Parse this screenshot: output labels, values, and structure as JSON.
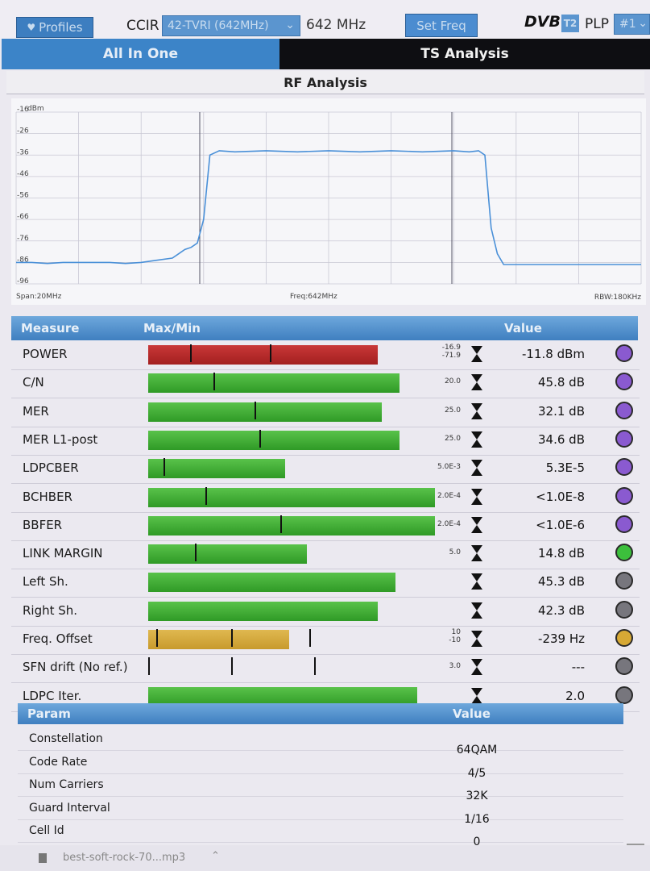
{
  "topbar": {
    "profiles_label": "Profiles",
    "standard": "CCIR",
    "channel": "42-TVRI (642MHz)",
    "frequency": "642 MHz",
    "set_freq_label": "Set Freq",
    "system": "DVB",
    "system_version": "T2",
    "plp_label": "PLP",
    "plp_value": "#1"
  },
  "tabs": [
    {
      "label": "All In One",
      "active": false
    },
    {
      "label": "TS Analysis",
      "active": true
    }
  ],
  "rf": {
    "title": "RF Analysis",
    "unit": "dBm",
    "y_ticks": [
      "-16",
      "-26",
      "-36",
      "-46",
      "-56",
      "-66",
      "-76",
      "-86",
      "-96"
    ],
    "span": "Span:20MHz",
    "freq": "Freq:642MHz",
    "rbw": "RBW:180KHz"
  },
  "chart_data": {
    "type": "line",
    "ylabel": "dBm",
    "ylim": [
      -96,
      -16
    ],
    "xlim": [
      632,
      652
    ],
    "series": [
      {
        "x": [
          632,
          632.5,
          633,
          633.5,
          634,
          634.5,
          635,
          635.5,
          636,
          636.5,
          637,
          637.2,
          637.4,
          637.6,
          637.8,
          638,
          638.2,
          638.5,
          639,
          640,
          641,
          642,
          643,
          644,
          645,
          646,
          646.5,
          646.8,
          647,
          647.2,
          647.4,
          647.6,
          648,
          649,
          650,
          651,
          652
        ],
        "y": [
          -86,
          -86,
          -86.5,
          -86,
          -86,
          -86,
          -86,
          -86.5,
          -86,
          -85,
          -84,
          -82,
          -80,
          -79,
          -77,
          -66,
          -36,
          -34,
          -34.5,
          -34,
          -34.5,
          -34,
          -34.5,
          -34,
          -34.5,
          -34,
          -34.5,
          -34,
          -36,
          -70,
          -82,
          -87,
          -87,
          -87,
          -87,
          -87,
          -87
        ]
      }
    ]
  },
  "measure": {
    "headers": {
      "measure": "Measure",
      "maxmin": "Max/Min",
      "value": "Value"
    },
    "rows": [
      {
        "label": "POWER",
        "range": [
          "-16.9",
          "-71.9"
        ],
        "value": "-11.8 dBm",
        "bar": 0.52,
        "color": "red",
        "ticks": [
          0.16,
          0.47
        ],
        "dot": "#8a5ad0"
      },
      {
        "label": "C/N",
        "range": [
          "20.0"
        ],
        "value": "45.8 dB",
        "bar": 0.57,
        "color": "green",
        "ticks": [
          0.25
        ],
        "dot": "#8a5ad0"
      },
      {
        "label": "MER",
        "range": [
          "25.0"
        ],
        "value": "32.1 dB",
        "bar": 0.53,
        "color": "green",
        "ticks": [
          0.41
        ],
        "dot": "#8a5ad0"
      },
      {
        "label": "MER L1-post",
        "range": [
          "25.0"
        ],
        "value": "34.6 dB",
        "bar": 0.57,
        "color": "green",
        "ticks": [
          0.43
        ],
        "dot": "#8a5ad0"
      },
      {
        "label": "LDPCBER",
        "range": [
          "5.0E-3"
        ],
        "value": "5.3E-5",
        "bar": 0.31,
        "color": "green",
        "ticks": [
          0.06
        ],
        "dot": "#8a5ad0"
      },
      {
        "label": "BCHBER",
        "range": [
          "2.0E-4"
        ],
        "value": "<1.0E-8",
        "bar": 0.65,
        "color": "green",
        "ticks": [
          0.22
        ],
        "dot": "#8a5ad0"
      },
      {
        "label": "BBFER",
        "range": [
          "2.0E-4"
        ],
        "value": "<1.0E-6",
        "bar": 0.65,
        "color": "green",
        "ticks": [
          0.51
        ],
        "dot": "#8a5ad0"
      },
      {
        "label": "LINK MARGIN",
        "range": [
          "5.0"
        ],
        "value": "14.8 dB",
        "bar": 0.36,
        "color": "green",
        "ticks": [
          0.18
        ],
        "dot": "#3cbf3c"
      },
      {
        "label": "Left Sh.",
        "range": [],
        "value": "45.3 dB",
        "bar": 0.56,
        "color": "green",
        "ticks": [],
        "dot": "#77767d"
      },
      {
        "label": "Right Sh.",
        "range": [],
        "value": "42.3 dB",
        "bar": 0.52,
        "color": "green",
        "ticks": [],
        "dot": "#77767d"
      },
      {
        "label": "Freq. Offset",
        "range": [
          "10",
          "-10"
        ],
        "value": "-239 Hz",
        "bar": 0.32,
        "color": "amber",
        "ticks": [
          0.03,
          0.32,
          0.62
        ],
        "dot": "#d7a935"
      },
      {
        "label": "SFN drift (No ref.)",
        "range": [
          "3.0"
        ],
        "value": "---",
        "bar": 0,
        "color": "green",
        "ticks": [
          0.0,
          0.32,
          0.64
        ],
        "dot": "#77767d"
      },
      {
        "label": "LDPC Iter.",
        "range": [],
        "value": "2.0",
        "bar": 0.61,
        "color": "green",
        "ticks": [],
        "dot": "#77767d"
      }
    ]
  },
  "param": {
    "headers": {
      "param": "Param",
      "value": "Value"
    },
    "rows": [
      {
        "label": "Constellation",
        "value": "64QAM"
      },
      {
        "label": "Code Rate",
        "value": "4/5"
      },
      {
        "label": "Num Carriers",
        "value": "32K"
      },
      {
        "label": "Guard Interval",
        "value": "1/16"
      },
      {
        "label": "Cell Id",
        "value": "0"
      }
    ]
  },
  "footer": {
    "filename": "best-soft-rock-70...mp3"
  }
}
